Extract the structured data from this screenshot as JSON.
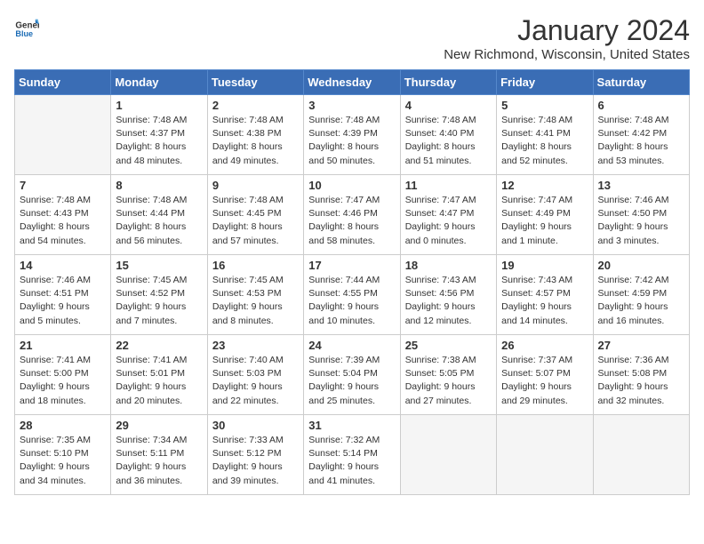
{
  "header": {
    "logo_line1": "General",
    "logo_line2": "Blue",
    "main_title": "January 2024",
    "subtitle": "New Richmond, Wisconsin, United States"
  },
  "weekdays": [
    "Sunday",
    "Monday",
    "Tuesday",
    "Wednesday",
    "Thursday",
    "Friday",
    "Saturday"
  ],
  "weeks": [
    [
      {
        "day": "",
        "empty": true
      },
      {
        "day": "1",
        "sunrise": "7:48 AM",
        "sunset": "4:37 PM",
        "daylight": "8 hours and 48 minutes."
      },
      {
        "day": "2",
        "sunrise": "7:48 AM",
        "sunset": "4:38 PM",
        "daylight": "8 hours and 49 minutes."
      },
      {
        "day": "3",
        "sunrise": "7:48 AM",
        "sunset": "4:39 PM",
        "daylight": "8 hours and 50 minutes."
      },
      {
        "day": "4",
        "sunrise": "7:48 AM",
        "sunset": "4:40 PM",
        "daylight": "8 hours and 51 minutes."
      },
      {
        "day": "5",
        "sunrise": "7:48 AM",
        "sunset": "4:41 PM",
        "daylight": "8 hours and 52 minutes."
      },
      {
        "day": "6",
        "sunrise": "7:48 AM",
        "sunset": "4:42 PM",
        "daylight": "8 hours and 53 minutes."
      }
    ],
    [
      {
        "day": "7",
        "sunrise": "7:48 AM",
        "sunset": "4:43 PM",
        "daylight": "8 hours and 54 minutes."
      },
      {
        "day": "8",
        "sunrise": "7:48 AM",
        "sunset": "4:44 PM",
        "daylight": "8 hours and 56 minutes."
      },
      {
        "day": "9",
        "sunrise": "7:48 AM",
        "sunset": "4:45 PM",
        "daylight": "8 hours and 57 minutes."
      },
      {
        "day": "10",
        "sunrise": "7:47 AM",
        "sunset": "4:46 PM",
        "daylight": "8 hours and 58 minutes."
      },
      {
        "day": "11",
        "sunrise": "7:47 AM",
        "sunset": "4:47 PM",
        "daylight": "9 hours and 0 minutes."
      },
      {
        "day": "12",
        "sunrise": "7:47 AM",
        "sunset": "4:49 PM",
        "daylight": "9 hours and 1 minute."
      },
      {
        "day": "13",
        "sunrise": "7:46 AM",
        "sunset": "4:50 PM",
        "daylight": "9 hours and 3 minutes."
      }
    ],
    [
      {
        "day": "14",
        "sunrise": "7:46 AM",
        "sunset": "4:51 PM",
        "daylight": "9 hours and 5 minutes."
      },
      {
        "day": "15",
        "sunrise": "7:45 AM",
        "sunset": "4:52 PM",
        "daylight": "9 hours and 7 minutes."
      },
      {
        "day": "16",
        "sunrise": "7:45 AM",
        "sunset": "4:53 PM",
        "daylight": "9 hours and 8 minutes."
      },
      {
        "day": "17",
        "sunrise": "7:44 AM",
        "sunset": "4:55 PM",
        "daylight": "9 hours and 10 minutes."
      },
      {
        "day": "18",
        "sunrise": "7:43 AM",
        "sunset": "4:56 PM",
        "daylight": "9 hours and 12 minutes."
      },
      {
        "day": "19",
        "sunrise": "7:43 AM",
        "sunset": "4:57 PM",
        "daylight": "9 hours and 14 minutes."
      },
      {
        "day": "20",
        "sunrise": "7:42 AM",
        "sunset": "4:59 PM",
        "daylight": "9 hours and 16 minutes."
      }
    ],
    [
      {
        "day": "21",
        "sunrise": "7:41 AM",
        "sunset": "5:00 PM",
        "daylight": "9 hours and 18 minutes."
      },
      {
        "day": "22",
        "sunrise": "7:41 AM",
        "sunset": "5:01 PM",
        "daylight": "9 hours and 20 minutes."
      },
      {
        "day": "23",
        "sunrise": "7:40 AM",
        "sunset": "5:03 PM",
        "daylight": "9 hours and 22 minutes."
      },
      {
        "day": "24",
        "sunrise": "7:39 AM",
        "sunset": "5:04 PM",
        "daylight": "9 hours and 25 minutes."
      },
      {
        "day": "25",
        "sunrise": "7:38 AM",
        "sunset": "5:05 PM",
        "daylight": "9 hours and 27 minutes."
      },
      {
        "day": "26",
        "sunrise": "7:37 AM",
        "sunset": "5:07 PM",
        "daylight": "9 hours and 29 minutes."
      },
      {
        "day": "27",
        "sunrise": "7:36 AM",
        "sunset": "5:08 PM",
        "daylight": "9 hours and 32 minutes."
      }
    ],
    [
      {
        "day": "28",
        "sunrise": "7:35 AM",
        "sunset": "5:10 PM",
        "daylight": "9 hours and 34 minutes."
      },
      {
        "day": "29",
        "sunrise": "7:34 AM",
        "sunset": "5:11 PM",
        "daylight": "9 hours and 36 minutes."
      },
      {
        "day": "30",
        "sunrise": "7:33 AM",
        "sunset": "5:12 PM",
        "daylight": "9 hours and 39 minutes."
      },
      {
        "day": "31",
        "sunrise": "7:32 AM",
        "sunset": "5:14 PM",
        "daylight": "9 hours and 41 minutes."
      },
      {
        "day": "",
        "empty": true
      },
      {
        "day": "",
        "empty": true
      },
      {
        "day": "",
        "empty": true
      }
    ]
  ]
}
